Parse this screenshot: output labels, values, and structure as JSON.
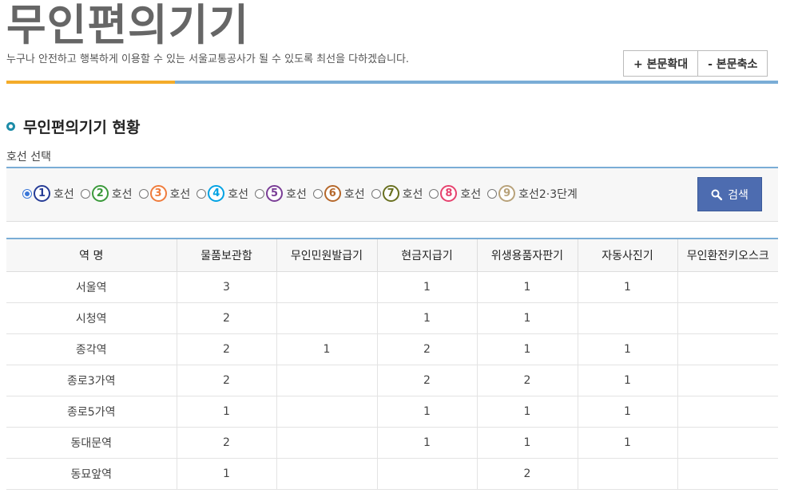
{
  "header": {
    "title": "무인편의기기",
    "description": "누구나 안전하고 행복하게 이용할 수 있는 서울교통공사가 될 수 있도록 최선을 다하겠습니다.",
    "font_increase": "+ 본문확대",
    "font_decrease": "- 본문축소"
  },
  "section": {
    "heading": "무인편의기기 현황",
    "line_select_label": "호선 선택"
  },
  "lines": [
    {
      "num": "1",
      "label": "호선",
      "color": "#263c96",
      "checked": true
    },
    {
      "num": "2",
      "label": "호선",
      "color": "#3c9a3c",
      "checked": false
    },
    {
      "num": "3",
      "label": "호선",
      "color": "#ef7c3c",
      "checked": false
    },
    {
      "num": "4",
      "label": "호선",
      "color": "#00a2e3",
      "checked": false
    },
    {
      "num": "5",
      "label": "호선",
      "color": "#7a3d96",
      "checked": false
    },
    {
      "num": "6",
      "label": "호선",
      "color": "#b5672a",
      "checked": false
    },
    {
      "num": "7",
      "label": "호선",
      "color": "#697020",
      "checked": false
    },
    {
      "num": "8",
      "label": "호선",
      "color": "#e6426e",
      "checked": false
    },
    {
      "num": "9",
      "label": "호선2·3단계",
      "color": "#b8a27a",
      "checked": false
    }
  ],
  "search": {
    "label": "검색",
    "icon": "search-icon"
  },
  "table": {
    "headers": [
      "역 명",
      "물품보관함",
      "무인민원발급기",
      "현금지급기",
      "위생용품자판기",
      "자동사진기",
      "무인환전키오스크"
    ],
    "rows": [
      [
        "서울역",
        "3",
        "",
        "1",
        "1",
        "1",
        ""
      ],
      [
        "시청역",
        "2",
        "",
        "1",
        "1",
        "",
        ""
      ],
      [
        "종각역",
        "2",
        "1",
        "2",
        "1",
        "1",
        ""
      ],
      [
        "종로3가역",
        "2",
        "",
        "2",
        "2",
        "1",
        ""
      ],
      [
        "종로5가역",
        "1",
        "",
        "1",
        "1",
        "1",
        ""
      ],
      [
        "동대문역",
        "2",
        "",
        "1",
        "1",
        "1",
        ""
      ],
      [
        "동묘앞역",
        "1",
        "",
        "",
        "2",
        "",
        ""
      ]
    ]
  }
}
